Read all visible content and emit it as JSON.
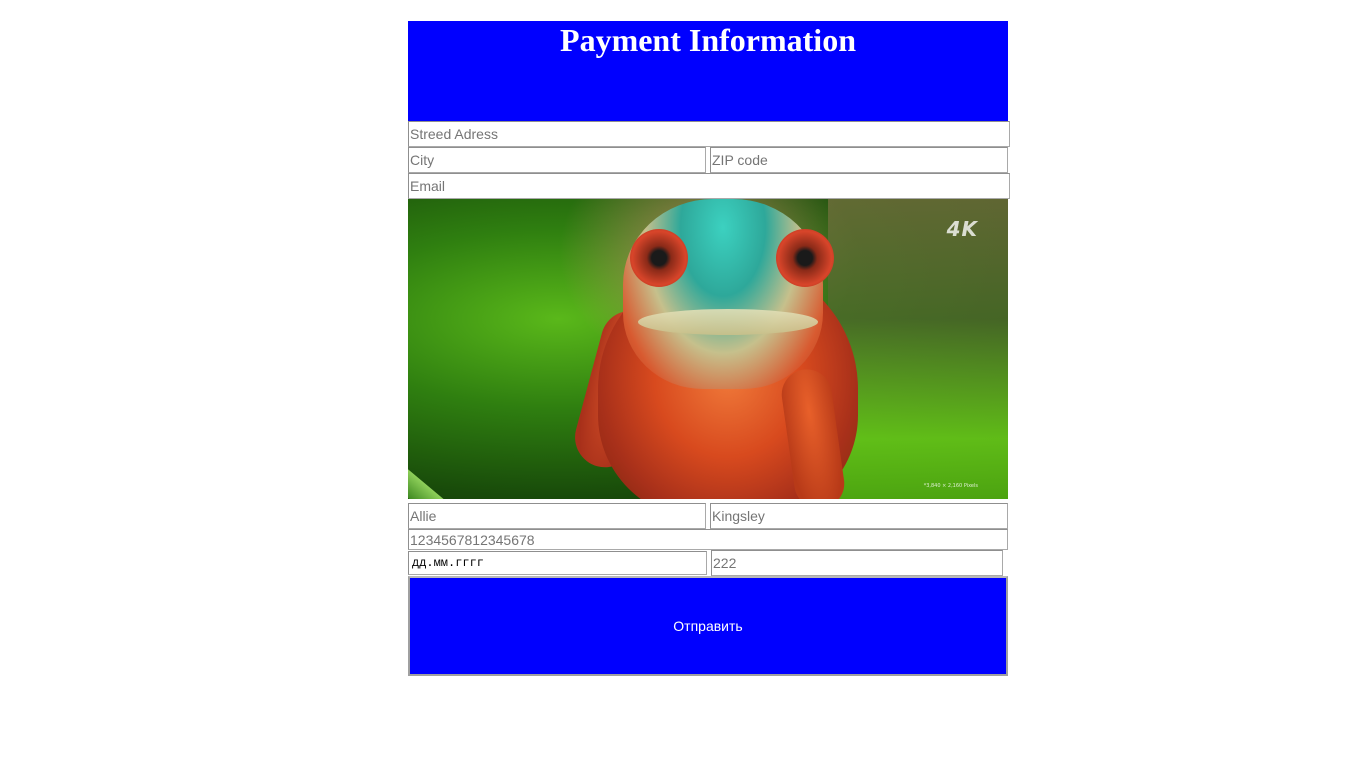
{
  "header": {
    "title": "Payment Information"
  },
  "address": {
    "street_placeholder": "Streed Adress",
    "city_placeholder": "City",
    "zip_placeholder": "ZIP code",
    "email_placeholder": "Email"
  },
  "image": {
    "badge": "4K",
    "resolution": "*3,840 × 2,160 Pixels"
  },
  "card": {
    "first_name_placeholder": "Allie",
    "last_name_placeholder": "Kingsley",
    "number_placeholder": "1234567812345678",
    "expiry_value": "дд.мм.гггг",
    "cvv_placeholder": "222"
  },
  "submit_label": "Отправить",
  "colors": {
    "accent": "#0000ff",
    "accent_text": "#ffffff"
  }
}
